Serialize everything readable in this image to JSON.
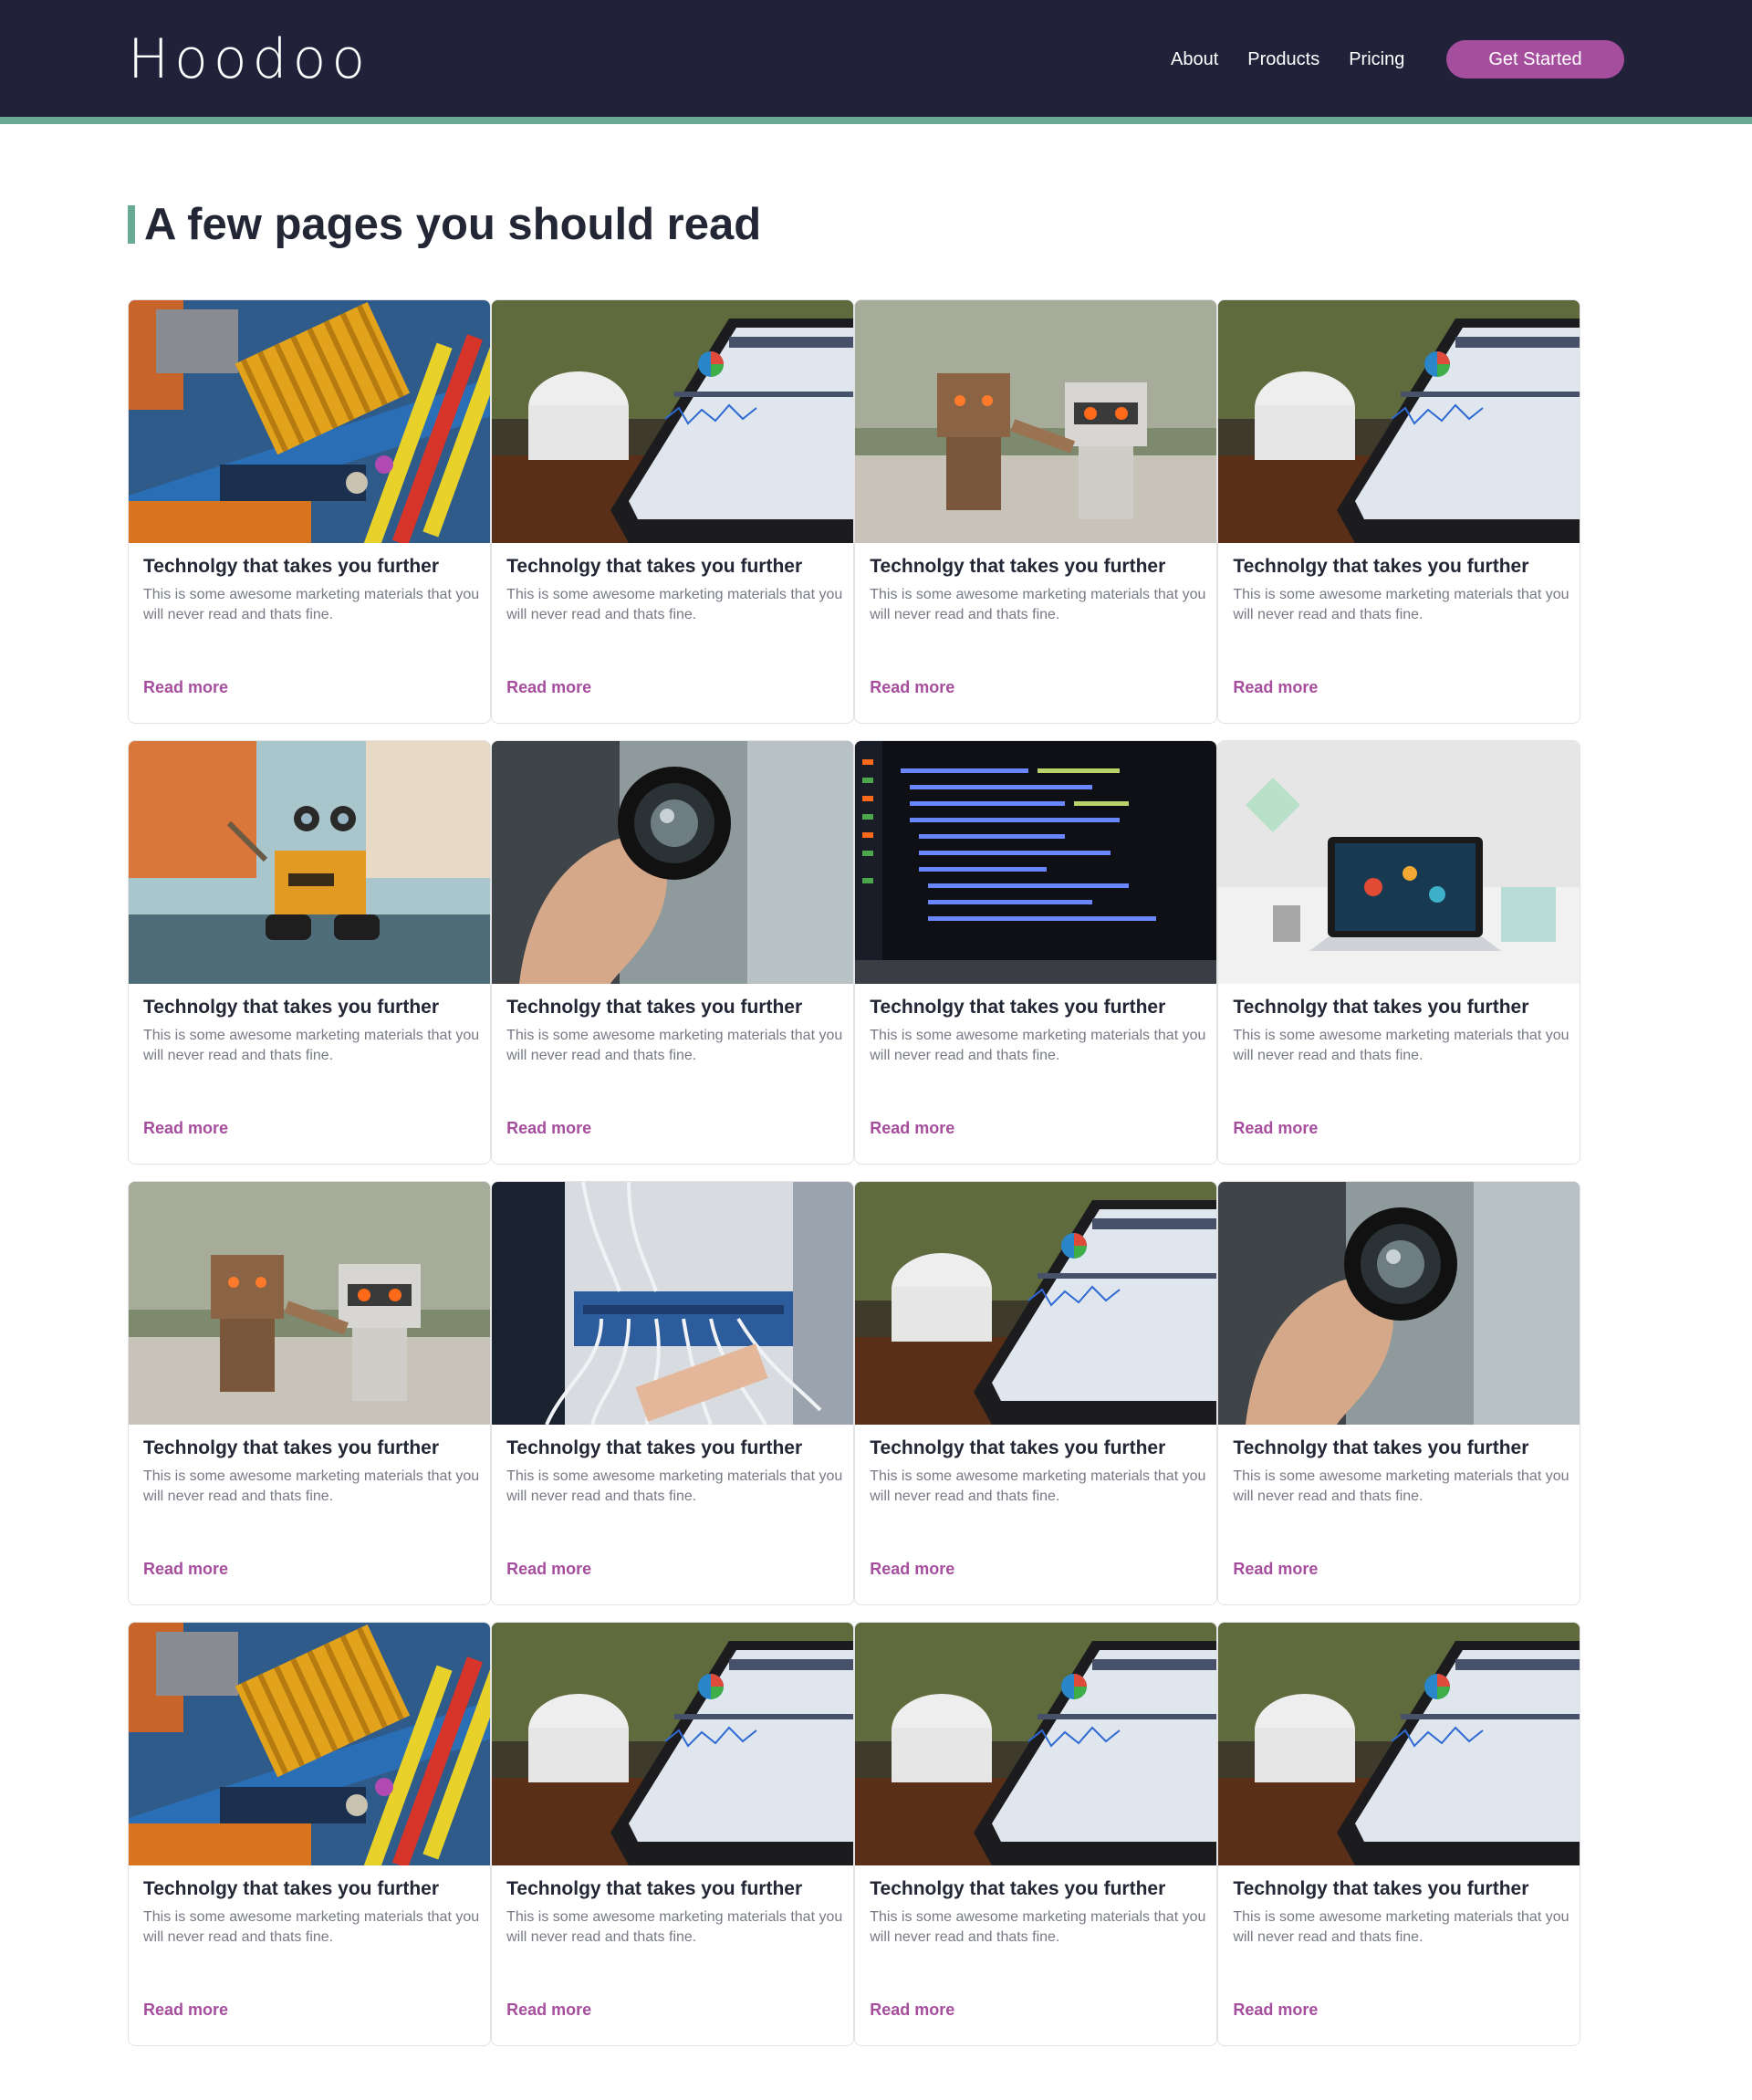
{
  "header": {
    "logo": "Hoodoo",
    "nav": [
      {
        "label": "About"
      },
      {
        "label": "Products"
      },
      {
        "label": "Pricing"
      }
    ],
    "cta_label": "Get Started"
  },
  "section": {
    "title": "A few pages you should read"
  },
  "cards": [
    {
      "image": "motherboard",
      "title": "Technolgy that takes you further",
      "description": "This is some awesome marketing materials that you will never read and thats fine.",
      "link": "Read more"
    },
    {
      "image": "tablet-analytics",
      "title": "Technolgy that takes you further",
      "description": "This is some awesome marketing materials that you will never read and thats fine.",
      "link": "Read more"
    },
    {
      "image": "robot-figures",
      "title": "Technolgy that takes you further",
      "description": "This is some awesome marketing materials that you will never read and thats fine.",
      "link": "Read more"
    },
    {
      "image": "tablet-analytics",
      "title": "Technolgy that takes you further",
      "description": "This is some awesome marketing materials that you will never read and thats fine.",
      "link": "Read more"
    },
    {
      "image": "walle-robot",
      "title": "Technolgy that takes you further",
      "description": "This is some awesome marketing materials that you will never read and thats fine.",
      "link": "Read more"
    },
    {
      "image": "hand-lens",
      "title": "Technolgy that takes you further",
      "description": "This is some awesome marketing materials that you will never read and thats fine.",
      "link": "Read more"
    },
    {
      "image": "code-screen",
      "title": "Technolgy that takes you further",
      "description": "This is some awesome marketing materials that you will never read and thats fine.",
      "link": "Read more"
    },
    {
      "image": "laptop-desk",
      "title": "Technolgy that takes you further",
      "description": "This is some awesome marketing materials that you will never read and thats fine.",
      "link": "Read more"
    },
    {
      "image": "robot-figures",
      "title": "Technolgy that takes you further",
      "description": "This is some awesome marketing materials that you will never read and thats fine.",
      "link": "Read more"
    },
    {
      "image": "network-rack",
      "title": "Technolgy that takes you further",
      "description": "This is some awesome marketing materials that you will never read and thats fine.",
      "link": "Read more"
    },
    {
      "image": "tablet-analytics",
      "title": "Technolgy that takes you further",
      "description": "This is some awesome marketing materials that you will never read and thats fine.",
      "link": "Read more"
    },
    {
      "image": "hand-lens",
      "title": "Technolgy that takes you further",
      "description": "This is some awesome marketing materials that you will never read and thats fine.",
      "link": "Read more"
    },
    {
      "image": "motherboard",
      "title": "Technolgy that takes you further",
      "description": "This is some awesome marketing materials that you will never read and thats fine.",
      "link": "Read more"
    },
    {
      "image": "tablet-analytics",
      "title": "Technolgy that takes you further",
      "description": "This is some awesome marketing materials that you will never read and thats fine.",
      "link": "Read more"
    },
    {
      "image": "tablet-analytics",
      "title": "Technolgy that takes you further",
      "description": "This is some awesome marketing materials that you will never read and thats fine.",
      "link": "Read more"
    },
    {
      "image": "tablet-analytics",
      "title": "Technolgy that takes you further",
      "description": "This is some awesome marketing materials that you will never read and thats fine.",
      "link": "Read more"
    }
  ],
  "colors": {
    "header_bg": "#21223a",
    "accent_green": "#6aa994",
    "accent_purple": "#a64e9e",
    "text_dark": "#232634",
    "text_muted": "#777a85"
  }
}
